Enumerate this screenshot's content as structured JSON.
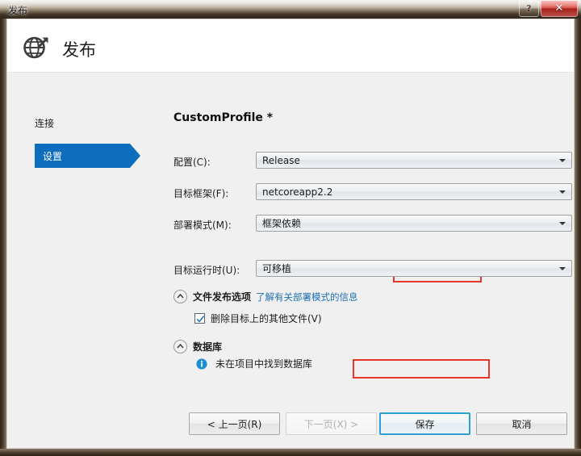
{
  "window": {
    "title": "发布",
    "help_button": "?",
    "close_button": "✕"
  },
  "header": {
    "title": "发布",
    "icon": "globe-publish-icon"
  },
  "sidebar": {
    "items": [
      {
        "label": "连接",
        "selected": false
      },
      {
        "label": "设置",
        "selected": true
      }
    ]
  },
  "main": {
    "profile_title": "CustomProfile *",
    "fields": [
      {
        "label": "配置(C):",
        "value": "Release"
      },
      {
        "label": "目标框架(F):",
        "value": "netcoreapp2.2"
      },
      {
        "label": "部署模式(M):",
        "value": "框架依赖"
      },
      {
        "label": "目标运行时(U):",
        "value": "可移植"
      }
    ],
    "deploy_link": "了解有关部署模式的信息",
    "sections": [
      {
        "title": "文件发布选项",
        "checkbox_label": "删除目标上的其他文件(V)",
        "checked": true
      },
      {
        "title": "数据库",
        "info_text": "未在项目中找到数据库"
      }
    ]
  },
  "footer": {
    "prev": "< 上一页(R)",
    "next": "下一页(X) >",
    "save": "保存",
    "cancel": "取消"
  },
  "colors": {
    "accent_blue": "#0c6dbe",
    "link_blue": "#1d6fb8",
    "highlight_red": "#e8342a",
    "default_button_border": "#2d9fd0",
    "info_blue": "#1d8fd6"
  }
}
